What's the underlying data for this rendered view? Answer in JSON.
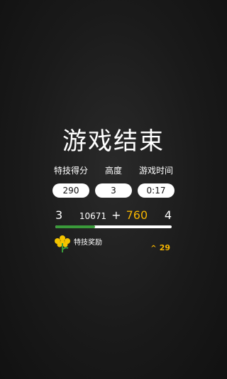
{
  "title": "游戏结束",
  "stats": [
    {
      "label": "特技得分",
      "value": "290"
    },
    {
      "label": "高度",
      "value": "3"
    },
    {
      "label": "游戏时间",
      "value": "0:17"
    }
  ],
  "level": {
    "current": "3",
    "next": "4",
    "progress_fraction": 0.34
  },
  "score": {
    "base": "10671",
    "plus": "+",
    "bonus": "760"
  },
  "trick_bonus": {
    "label": "特技奖励",
    "count": "29",
    "icon": "flower-icon",
    "indicator_icon": "caret-up-icon"
  },
  "colors": {
    "accent": "#f4b400",
    "progress": "#3a9a3a",
    "background": "#1a1a1a"
  }
}
